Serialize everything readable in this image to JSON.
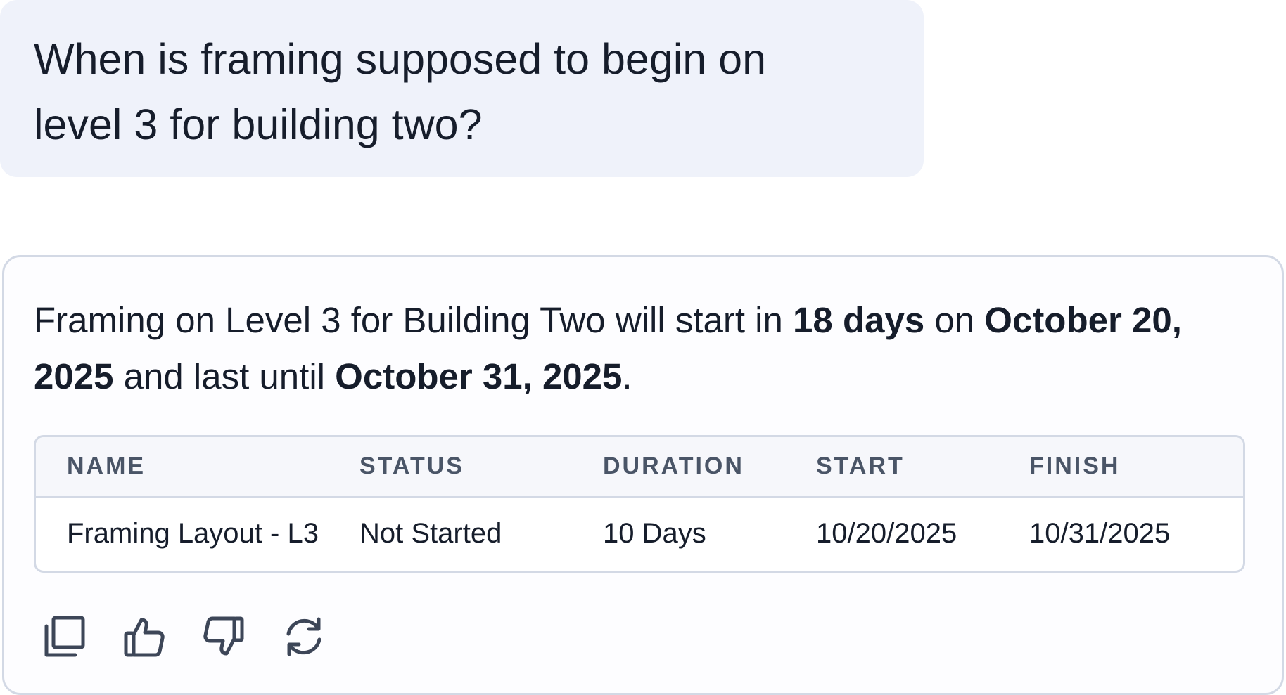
{
  "user_message": {
    "text": "When is framing supposed to begin on level 3 for building two?"
  },
  "assistant_reply": {
    "segments": [
      {
        "text": "Framing on Level 3 for Building Two will start in ",
        "bold": false
      },
      {
        "text": "18 days",
        "bold": true
      },
      {
        "text": " on ",
        "bold": false
      },
      {
        "text": "October 20, 2025",
        "bold": true
      },
      {
        "text": " and last until ",
        "bold": false
      },
      {
        "text": "October 31, 2025",
        "bold": true
      },
      {
        "text": ".",
        "bold": false
      }
    ],
    "table": {
      "columns": [
        "NAME",
        "STATUS",
        "DURATION",
        "START",
        "FINISH"
      ],
      "rows": [
        [
          "Framing Layout - L3",
          "Not Started",
          "10 Days",
          "10/20/2025",
          "10/31/2025"
        ]
      ]
    },
    "actions": [
      {
        "icon": "copy-icon",
        "name": "copy-button"
      },
      {
        "icon": "thumbs-up-icon",
        "name": "thumbs-up-button"
      },
      {
        "icon": "thumbs-down-icon",
        "name": "thumbs-down-button"
      },
      {
        "icon": "regenerate-icon",
        "name": "regenerate-button"
      }
    ]
  },
  "colors": {
    "bubble_bg": "#eff2fa",
    "border": "#d3d9e5",
    "text": "#161d2b",
    "header_text": "#4a5567"
  }
}
